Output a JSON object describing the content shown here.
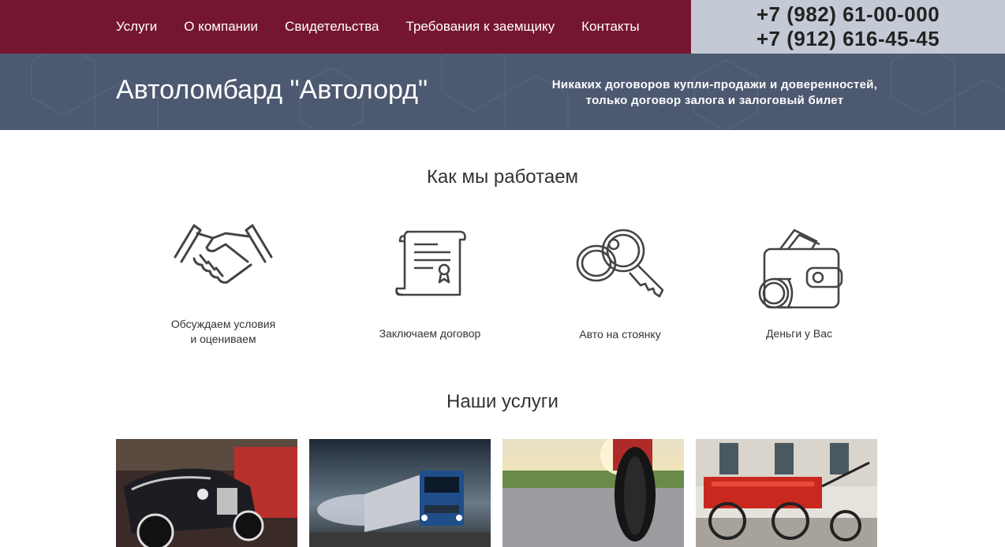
{
  "nav": {
    "items": [
      {
        "label": "Услуги"
      },
      {
        "label": "О компании"
      },
      {
        "label": "Свидетельства"
      },
      {
        "label": "Требования к заемщику"
      },
      {
        "label": "Контакты"
      }
    ]
  },
  "phones": [
    "+7 (982) 61-00-000",
    "+7 (912) 616-45-45"
  ],
  "hero": {
    "title": "Автоломбард \"Автолорд\"",
    "subtitle_line1": "Никаких договоров купли-продажи и доверенностей,",
    "subtitle_line2": "только договор залога и залоговый билет"
  },
  "how_we_work": {
    "title": "Как мы работаем",
    "steps": [
      {
        "icon": "handshake-icon",
        "line1": "Обсуждаем условия",
        "line2": "и оцениваем"
      },
      {
        "icon": "contract-scroll-icon",
        "line1": "Заключаем договор",
        "line2": ""
      },
      {
        "icon": "key-icon",
        "line1": "Авто на стоянку",
        "line2": ""
      },
      {
        "icon": "wallet-icon",
        "line1": "Деньги у Вас",
        "line2": ""
      }
    ]
  },
  "services": {
    "title": "Наши услуги",
    "cards": [
      {
        "image": "vintage-car-photo"
      },
      {
        "image": "truck-photo"
      },
      {
        "image": "motorcycle-photo"
      },
      {
        "image": "special-vehicle-photo"
      }
    ]
  },
  "colors": {
    "topbar": "#751631",
    "phones_bg": "#c3cad6",
    "hero_bg": "#4d5970"
  }
}
